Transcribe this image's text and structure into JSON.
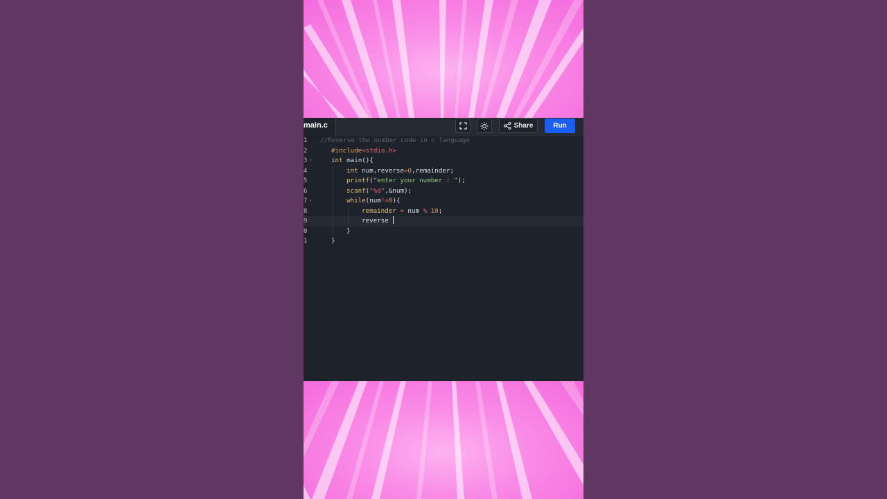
{
  "editor": {
    "file_tab": "main.c",
    "share_label": "Share",
    "run_label": "Run",
    "icons": {
      "fullscreen": "fullscreen-icon",
      "theme": "sun-icon",
      "share": "share-icon"
    },
    "colors": {
      "run_button": "#1a5ff0",
      "background": "#1e222a",
      "backdrop": "#603663",
      "burst": "#f66fdc"
    }
  },
  "code": {
    "line_numbers": [
      "1",
      "2",
      "3",
      "4",
      "5",
      "6",
      "7",
      "8",
      "9",
      "0",
      "1"
    ],
    "lines": [
      {
        "comment": "//Reverse the number code in c language"
      },
      {
        "pre": "#include",
        "str": "<stdio.h>"
      },
      {
        "kw": "int",
        "rest": " main(){"
      },
      {
        "kw": "int",
        "rest1": " num,reverse",
        "op": "=",
        "num": "0",
        "rest2": ",remainder;"
      },
      {
        "fn": "printf",
        "open": "(",
        "str": "\"enter your number : \"",
        "close": ");"
      },
      {
        "fn": "scanf",
        "open": "(",
        "str": "\"%d\"",
        "close": ",&num);"
      },
      {
        "kw": "while",
        "rest1": "(num",
        "op": "!=",
        "num": "0",
        "rest2": "){"
      },
      {
        "rest1": "remainder ",
        "op": "=",
        "rest2": " num ",
        "op2": "%",
        "num": "10",
        "rest3": ";"
      },
      {
        "rest1": "reverse "
      },
      {
        "rest1": "}"
      },
      {
        "rest1": "}"
      }
    ]
  }
}
